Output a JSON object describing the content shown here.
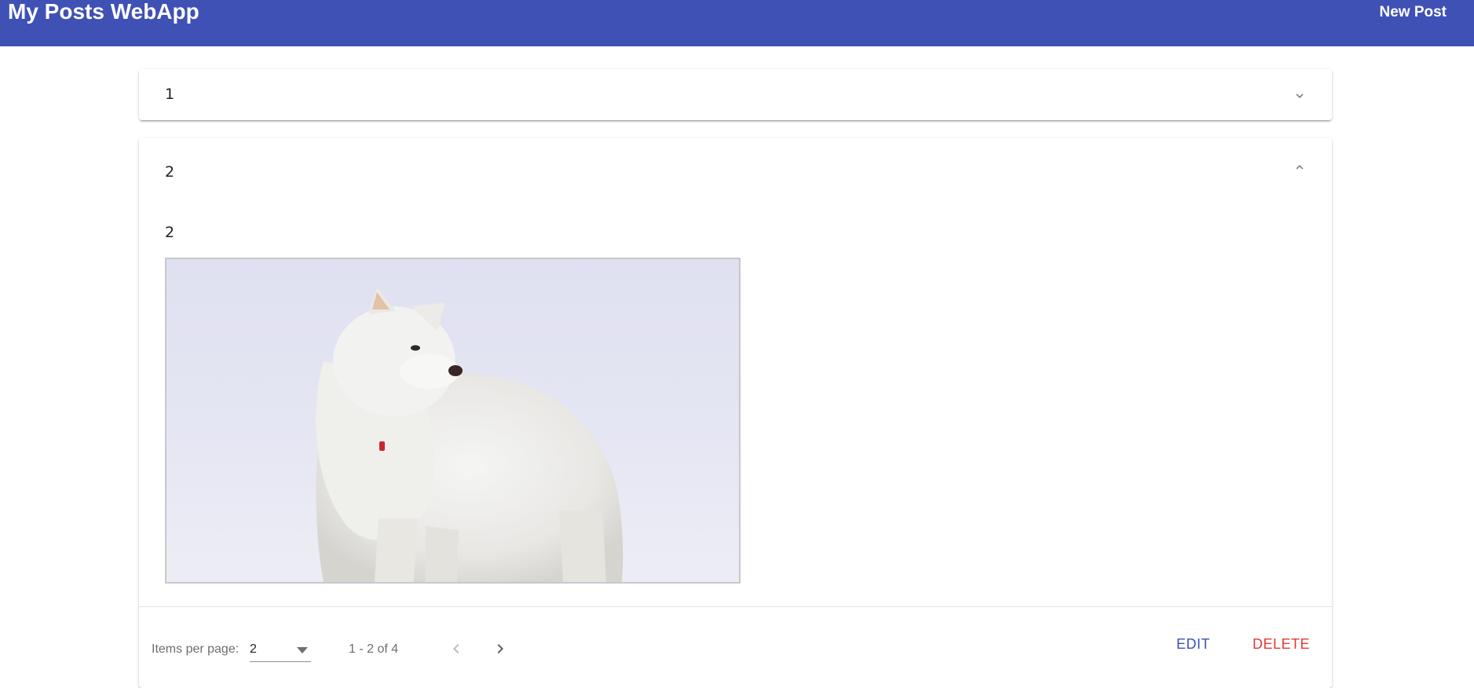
{
  "app": {
    "title": "My Posts WebApp",
    "new_post_label": "New Post",
    "primary_color": "#3f51b5",
    "warn_color": "#e53935"
  },
  "posts": [
    {
      "title": "1",
      "expanded": false,
      "icon": "chevron-down-icon"
    },
    {
      "title": "2",
      "expanded": true,
      "icon": "chevron-up-icon",
      "content": "2",
      "image": "white-samoyed-dog-photo"
    }
  ],
  "actions": {
    "edit_label": "EDIT",
    "delete_label": "DELETE"
  },
  "paginator": {
    "items_per_page_label": "Items per page:",
    "page_size": "2",
    "range_label": "1 - 2 of 4",
    "prev_icon": "chevron-left-icon",
    "next_icon": "chevron-right-icon"
  }
}
